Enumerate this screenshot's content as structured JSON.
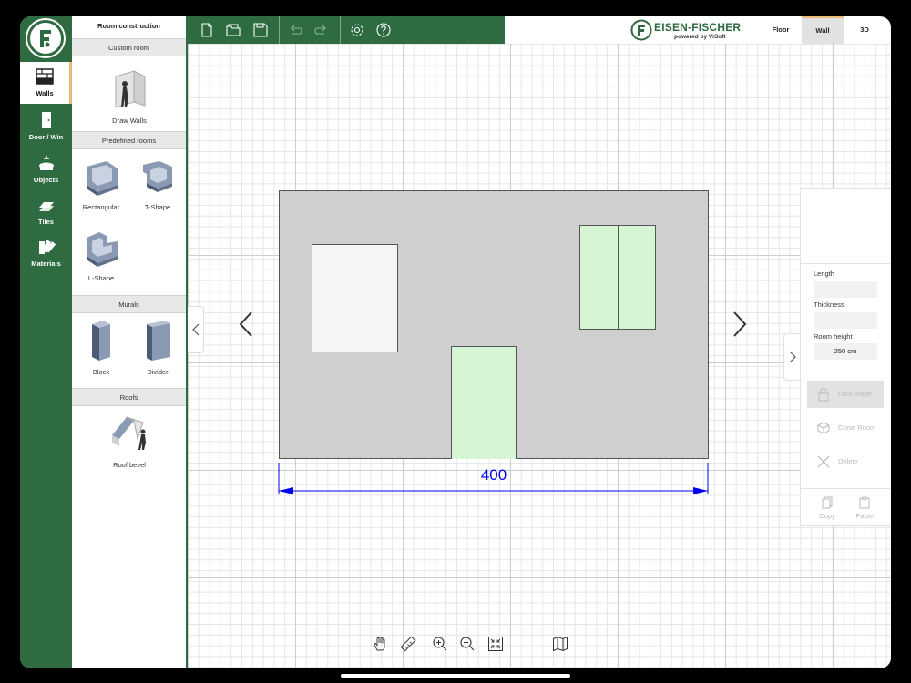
{
  "rail": {
    "items": [
      {
        "label": "Walls",
        "icon": "walls-icon",
        "active": true
      },
      {
        "label": "Door / Win",
        "icon": "door-icon",
        "active": false
      },
      {
        "label": "Objects",
        "icon": "objects-icon",
        "active": false
      },
      {
        "label": "Tiles",
        "icon": "tiles-icon",
        "active": false
      },
      {
        "label": "Materials",
        "icon": "materials-icon",
        "active": false
      }
    ]
  },
  "panel": {
    "title": "Room construction",
    "sections": {
      "custom": "Custom room",
      "predefined": "Predefined rooms",
      "murals": "Murals",
      "roofs": "Roofs"
    },
    "tiles": {
      "draw_walls": "Draw Walls",
      "rectangular": "Rectangular",
      "t_shape": "T-Shape",
      "l_shape": "L-Shape",
      "block": "Block",
      "divider": "Divider",
      "roof_bevel": "Roof bevel"
    }
  },
  "toolbar": {
    "icons": [
      "new-file-icon",
      "open-folder-icon",
      "save-icon",
      "undo-icon",
      "redo-icon",
      "settings-icon",
      "help-icon"
    ]
  },
  "brand": {
    "name": "EISEN-FISCHER",
    "sub": "powered by ViSoft"
  },
  "view_tabs": [
    {
      "label": "Floor",
      "active": false
    },
    {
      "label": "Wall",
      "active": true
    },
    {
      "label": "3D",
      "active": false
    }
  ],
  "properties": {
    "length_label": "Length",
    "length_value": "",
    "thickness_label": "Thickness",
    "thickness_value": "",
    "room_height_label": "Room height",
    "room_height_value": "250 cm",
    "lock_angle": "Lock Angle",
    "close_room": "Close Room",
    "delete": "Delete",
    "copy": "Copy",
    "paste": "Paste"
  },
  "canvas": {
    "dimension": "400",
    "wall_color": "#cfcfcf",
    "door_window_color": "#d5f5d5",
    "dimension_color": "#0000ee"
  },
  "bottom_tools": [
    "hand-icon",
    "ruler-icon",
    "zoom-in-icon",
    "zoom-out-icon",
    "fit-screen-icon",
    "map-icon"
  ],
  "colors": {
    "brand_green": "#2e6b41",
    "accent": "#e8b97a"
  }
}
